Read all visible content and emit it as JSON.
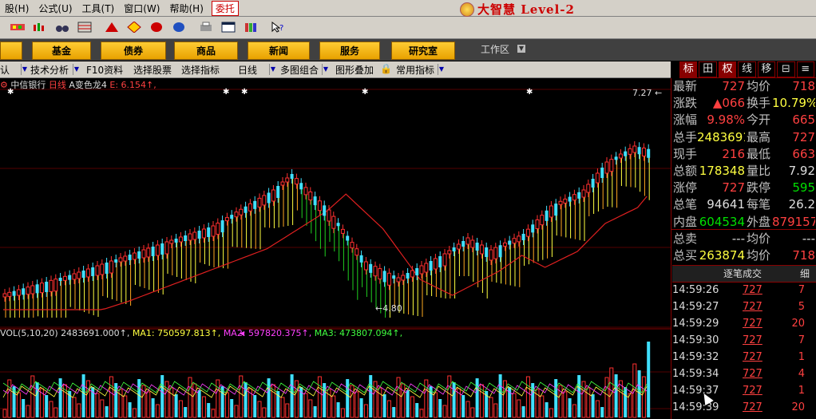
{
  "menu": {
    "items": [
      "股(H)",
      "公式(U)",
      "工具(T)",
      "窗口(W)",
      "帮助(H)"
    ],
    "delegate": "委托"
  },
  "app": {
    "title": "大智慧 Level-2"
  },
  "nav": {
    "buttons": [
      "基金",
      "债券",
      "商品",
      "新闻",
      "服务",
      "研究室"
    ],
    "workspace": "工作区"
  },
  "subbar": {
    "items": [
      "认",
      "技术分析",
      "F10资料",
      "选择股票",
      "选择指标",
      "日线",
      "多图组合",
      "图形叠加",
      "常用指标"
    ]
  },
  "right_tabs": [
    "标",
    "田",
    "权",
    "线",
    "移",
    "⊟",
    "≡"
  ],
  "chart": {
    "stock_name": "中信银行",
    "period": "日线",
    "indicator": "A变色龙4",
    "indicator_value": "E: 6.154↑,",
    "high_label": "7.27",
    "low_label": "4.80",
    "vol_title": "VOL(5,10,20) 2483691.000↑,",
    "ma1": "MA1: 750597.813↑,",
    "ma2": "MA2: 597820.375↑,",
    "ma3": "MA3: 473807.094↑,",
    "colors": {
      "up": "#ff3030",
      "down": "#40e0ff",
      "ma": "#e02020",
      "bull": "#ffff40",
      "bear": "#20d020"
    }
  },
  "quote": {
    "rows": [
      {
        "l1": "最新",
        "v1": "727",
        "c1": "red",
        "l2": "均价",
        "v2": "718",
        "c2": "red"
      },
      {
        "l1": "涨跌",
        "v1": "▲066",
        "c1": "red",
        "l2": "换手",
        "v2": "10.79%",
        "c2": "yellow"
      },
      {
        "l1": "涨幅",
        "v1": "9.98%",
        "c1": "red",
        "l2": "今开",
        "v2": "665",
        "c2": "red"
      },
      {
        "l1": "总手",
        "v1": "2483691",
        "c1": "yellow",
        "l2": "最高",
        "v2": "727",
        "c2": "red"
      },
      {
        "l1": "现手",
        "v1": "216",
        "c1": "red",
        "l2": "最低",
        "v2": "663",
        "c2": "red"
      },
      {
        "l1": "总额",
        "v1": "178348",
        "c1": "yellow",
        "l2": "量比",
        "v2": "7.92",
        "c2": "white"
      },
      {
        "l1": "涨停",
        "v1": "727",
        "c1": "red",
        "l2": "跌停",
        "v2": "595",
        "c2": "green"
      },
      {
        "l1": "总笔",
        "v1": "94641",
        "c1": "white",
        "l2": "每笔",
        "v2": "26.2",
        "c2": "white"
      },
      {
        "l1": "内盘",
        "v1": "604534",
        "c1": "green",
        "l2": "外盘",
        "v2": "879157",
        "c2": "red"
      },
      {
        "l1": "总卖",
        "v1": "---",
        "c1": "white",
        "l2": "均价",
        "v2": "---",
        "c2": "white"
      },
      {
        "l1": "总买",
        "v1": "263874",
        "c1": "yellow",
        "l2": "均价",
        "v2": "718",
        "c2": "red"
      }
    ]
  },
  "trades": {
    "header": "逐笔成交",
    "header_right": "细",
    "rows": [
      {
        "time": "14:59:26",
        "price": "727",
        "vol": "7"
      },
      {
        "time": "14:59:27",
        "price": "727",
        "vol": "5"
      },
      {
        "time": "14:59:29",
        "price": "727",
        "vol": "20"
      },
      {
        "time": "14:59:30",
        "price": "727",
        "vol": "7"
      },
      {
        "time": "14:59:32",
        "price": "727",
        "vol": "1"
      },
      {
        "time": "14:59:34",
        "price": "727",
        "vol": "4"
      },
      {
        "time": "14:59:37",
        "price": "727",
        "vol": "1"
      },
      {
        "time": "14:59:39",
        "price": "727",
        "vol": "20"
      }
    ]
  }
}
